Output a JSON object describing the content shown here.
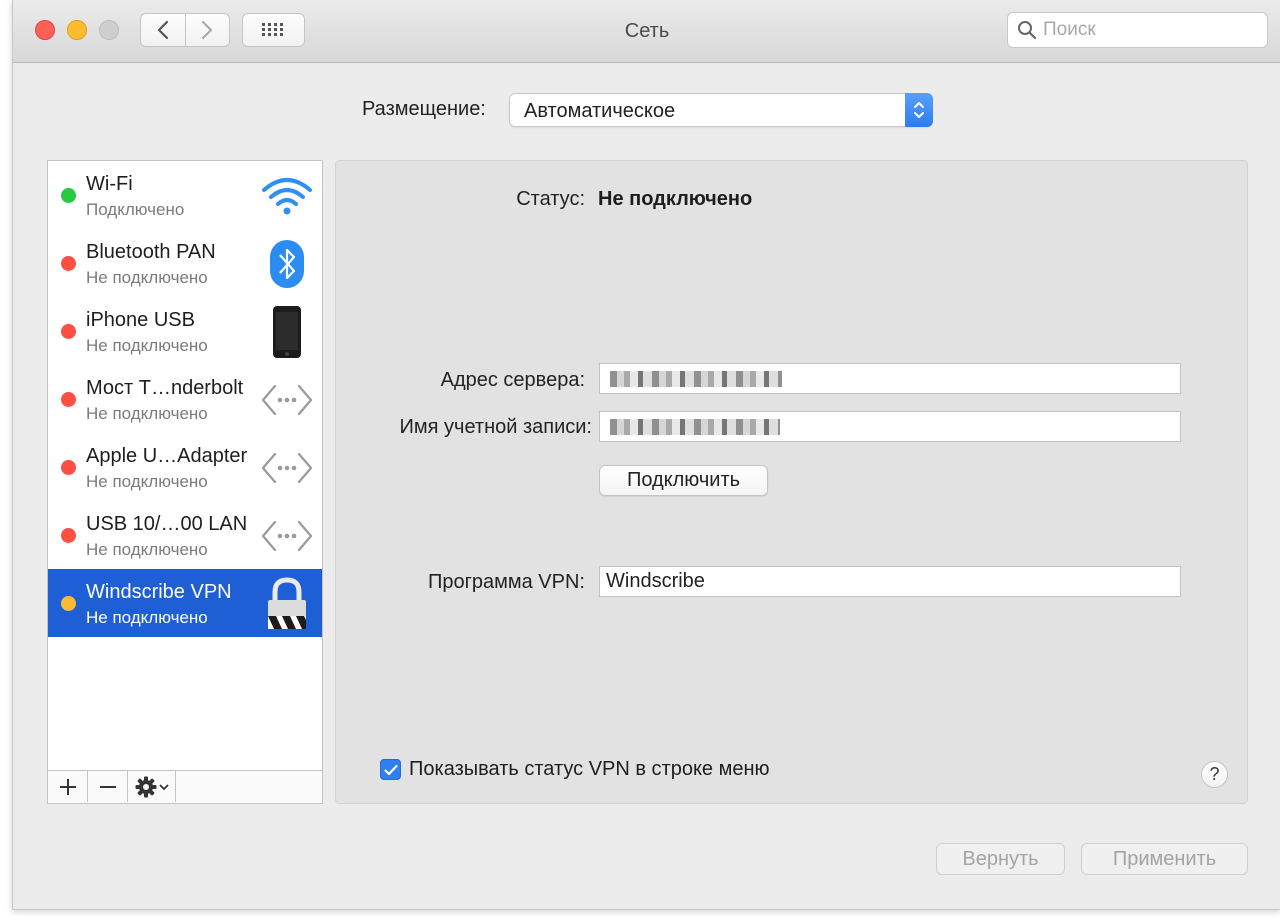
{
  "window": {
    "title": "Сеть",
    "search_placeholder": "Поиск"
  },
  "location": {
    "label": "Размещение:",
    "value": "Автоматическое"
  },
  "services": [
    {
      "name": "Wi-Fi",
      "status": "Подключено",
      "status_color": "#28c940",
      "icon": "wifi-icon"
    },
    {
      "name": "Bluetooth PAN",
      "status": "Не подключено",
      "status_color": "#fe4f45",
      "icon": "bluetooth-icon"
    },
    {
      "name": "iPhone USB",
      "status": "Не подключено",
      "status_color": "#fe4f45",
      "icon": "iphone-icon"
    },
    {
      "name": "Мост T…nderbolt",
      "status": "Не подключено",
      "status_color": "#fe4f45",
      "icon": "ethernet-icon"
    },
    {
      "name": "Apple U…Adapter",
      "status": "Не подключено",
      "status_color": "#fe4f45",
      "icon": "ethernet-icon"
    },
    {
      "name": "USB 10/…00 LAN",
      "status": "Не подключено",
      "status_color": "#fe4f45",
      "icon": "ethernet-icon"
    },
    {
      "name": "Windscribe VPN",
      "status": "Не подключено",
      "status_color": "#fdbc2f",
      "icon": "vpn-lock-icon",
      "selected": true
    }
  ],
  "detail": {
    "status_label": "Статус:",
    "status_value": "Не подключено",
    "server_label": "Адрес сервера:",
    "account_label": "Имя учетной записи:",
    "connect_label": "Подключить",
    "vpn_app_label": "Программа VPN:",
    "vpn_app_value": "Windscribe",
    "show_status_label": "Показывать статус VPN в строке меню",
    "show_status_checked": true,
    "help_label": "?"
  },
  "footer": {
    "revert_label": "Вернуть",
    "apply_label": "Применить"
  },
  "colors": {
    "accent": "#2f7ff3",
    "selection": "#1e5fd6"
  }
}
